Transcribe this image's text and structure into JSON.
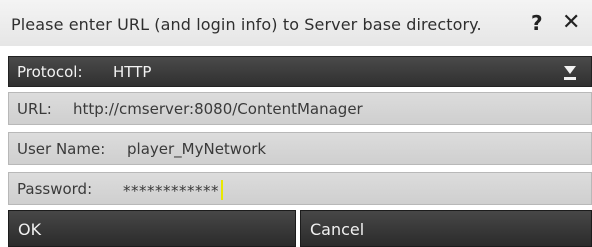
{
  "dialog": {
    "title": "Please enter URL (and login info) to Server base directory.",
    "help_label": "?",
    "close_label": "✕"
  },
  "protocol": {
    "label": "Protocol:",
    "value": "HTTP"
  },
  "url": {
    "label": "URL:",
    "value": "http://cmserver:8080/ContentManager"
  },
  "username": {
    "label": "User Name:",
    "value": "player_MyNetwork"
  },
  "password": {
    "label": "Password:",
    "value": "************"
  },
  "buttons": {
    "ok_label": "OK",
    "cancel_label": "Cancel"
  },
  "colors": {
    "dark_bar": "#3a3a3a",
    "field_bg": "#d6d6d6",
    "caret": "#e8e800"
  }
}
